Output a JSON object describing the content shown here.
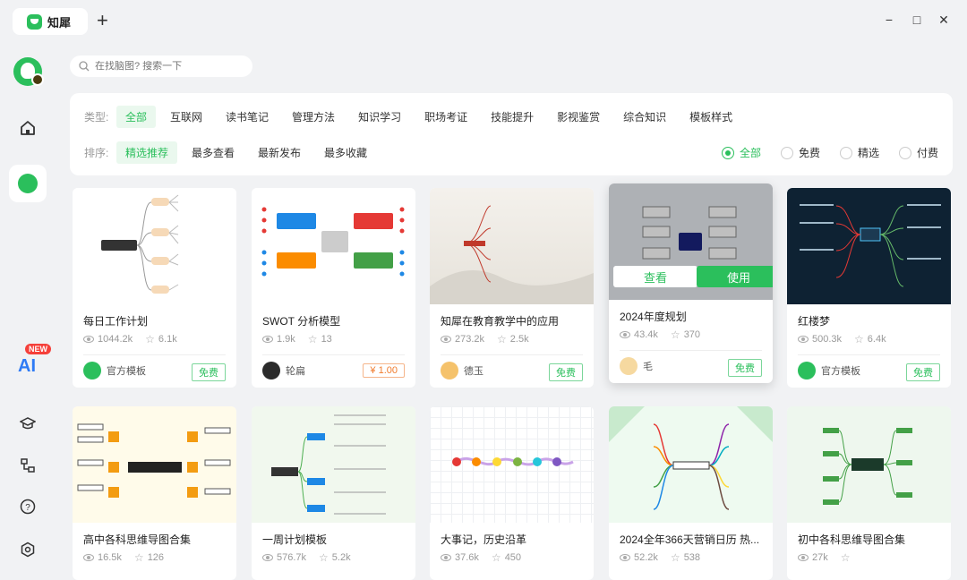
{
  "app": {
    "tab_title": "知犀",
    "new_tab": "+"
  },
  "window": {
    "minimize": "−",
    "maximize": "□",
    "close": "✕"
  },
  "search": {
    "placeholder": "在找脑图? 搜索一下"
  },
  "sidebar": {
    "ai_new": "NEW",
    "ai_label": "AI"
  },
  "filters": {
    "type_label": "类型:",
    "types": [
      "全部",
      "互联网",
      "读书笔记",
      "管理方法",
      "知识学习",
      "职场考证",
      "技能提升",
      "影视鉴赏",
      "综合知识",
      "模板样式"
    ],
    "sort_label": "排序:",
    "sorts": [
      "精选推荐",
      "最多查看",
      "最新发布",
      "最多收藏"
    ],
    "price_filters": [
      "全部",
      "免费",
      "精选",
      "付费"
    ]
  },
  "cards": [
    {
      "title": "每日工作计划",
      "views": "1044.2k",
      "stars": "6.1k",
      "author": "官方模板",
      "price": "免费"
    },
    {
      "title": "SWOT 分析模型",
      "views": "1.9k",
      "stars": "13",
      "author": "轮扁",
      "price": "¥ 1.00"
    },
    {
      "title": "知犀在教育教学中的应用",
      "views": "273.2k",
      "stars": "2.5k",
      "author": "德玉",
      "price": "免费"
    },
    {
      "title": "2024年度规划",
      "views": "43.4k",
      "stars": "370",
      "author": "毛",
      "price": "免费",
      "view_btn": "查看",
      "use_btn": "使用"
    },
    {
      "title": "红楼梦",
      "views": "500.3k",
      "stars": "6.4k",
      "author": "官方模板",
      "price": "免费"
    },
    {
      "title": "高中各科思维导图合集",
      "views": "16.5k",
      "stars": "126"
    },
    {
      "title": "一周计划模板",
      "views": "576.7k",
      "stars": "5.2k"
    },
    {
      "title": "大事记，历史沿革",
      "views": "37.6k",
      "stars": "450"
    },
    {
      "title": "2024全年366天营销日历 热...",
      "views": "52.2k",
      "stars": "538"
    },
    {
      "title": "初中各科思维导图合集",
      "views": "27k",
      "stars": ""
    }
  ],
  "colors": {
    "accent": "#2bbf5c",
    "paid": "#f07b2d",
    "ai": "#2f7bf5",
    "new_badge": "#f5403a"
  }
}
